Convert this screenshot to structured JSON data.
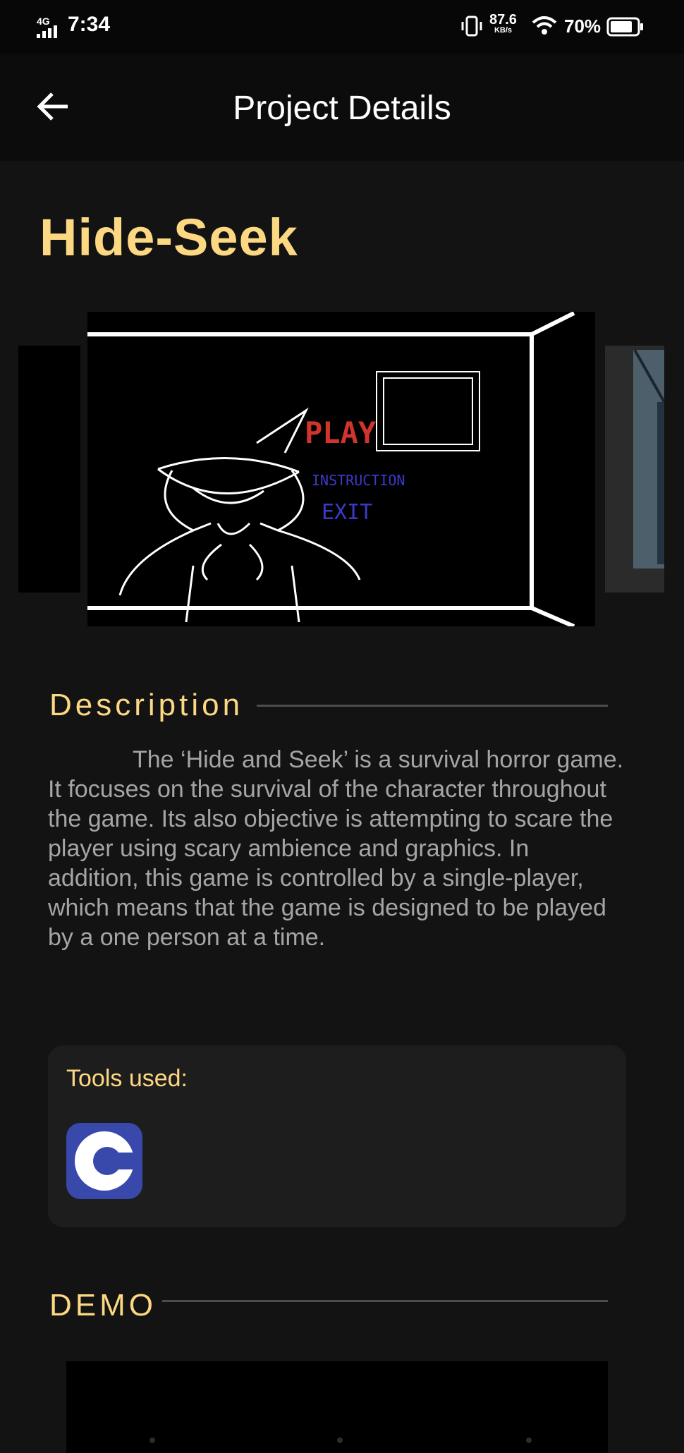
{
  "status_bar": {
    "network": "4G",
    "time": "7:34",
    "speed_value": "87.6",
    "speed_unit": "KB/s",
    "battery": "70%"
  },
  "app_bar": {
    "title": "Project Details"
  },
  "project": {
    "title": "Hide-Seek",
    "screenshot_menu": [
      "PLAY",
      "INSTRUCTION",
      "EXIT"
    ]
  },
  "description": {
    "heading": "Description",
    "text": "The ‘Hide and Seek’ is a survival horror game. It focuses on the survival of the character throughout the game. Its also objective is attempting to scare the player using scary ambience and graphics. In addition, this game is controlled by a single-player, which means that the game is designed to be played by a one person at a time."
  },
  "tools": {
    "label": "Tools used:",
    "items": [
      {
        "icon": "c-language-icon",
        "color": "#3949ab"
      }
    ]
  },
  "demo": {
    "heading": "DEMO"
  },
  "colors": {
    "accent": "#fcd882",
    "background": "#131313",
    "card": "#1d1d1d"
  }
}
